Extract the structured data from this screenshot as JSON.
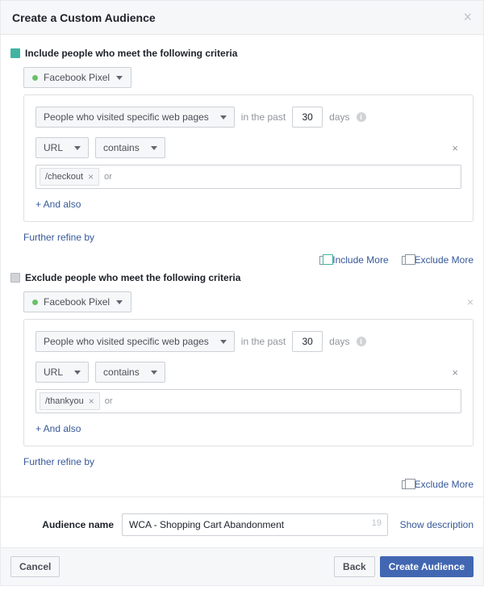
{
  "modal": {
    "title": "Create a Custom Audience"
  },
  "include": {
    "heading": "Include people who meet the following criteria",
    "source": "Facebook Pixel",
    "visitor_rule": "People who visited specific web pages",
    "past_label_pre": "in the past",
    "past_days": "30",
    "past_label_post": "days",
    "field": "URL",
    "operator": "contains",
    "token": "/checkout",
    "or": "or",
    "and_also": "+ And also",
    "refine": "Further refine by"
  },
  "exclude": {
    "heading": "Exclude people who meet the following criteria",
    "source": "Facebook Pixel",
    "visitor_rule": "People who visited specific web pages",
    "past_label_pre": "in the past",
    "past_days": "30",
    "past_label_post": "days",
    "field": "URL",
    "operator": "contains",
    "token": "/thankyou",
    "or": "or",
    "and_also": "+ And also",
    "refine": "Further refine by"
  },
  "actions": {
    "include_more": "Include More",
    "exclude_more": "Exclude More"
  },
  "name": {
    "label": "Audience name",
    "value": "WCA - Shopping Cart Abandonment",
    "counter": "19",
    "show_description": "Show description"
  },
  "footer": {
    "cancel": "Cancel",
    "back": "Back",
    "create": "Create Audience"
  }
}
